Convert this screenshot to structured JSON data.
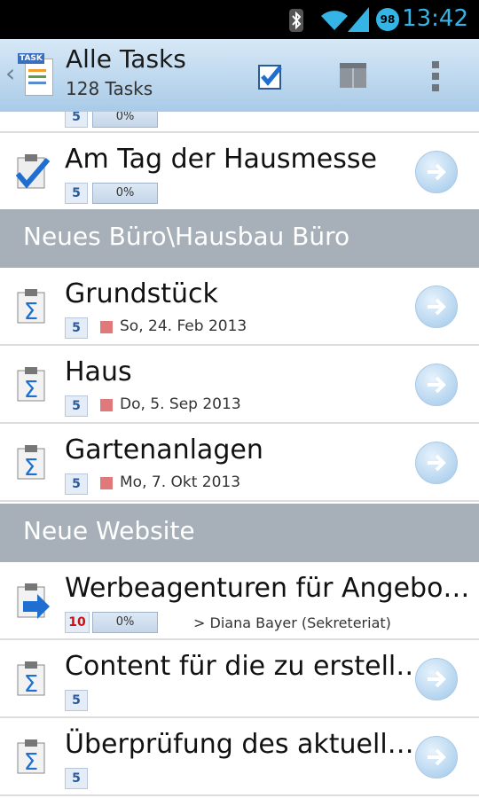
{
  "status": {
    "time": "13:42",
    "battery": "98"
  },
  "appbar": {
    "title": "Alle Tasks",
    "subtitle": "128 Tasks",
    "app_badge": "TASK"
  },
  "rows": {
    "top": {
      "prio": "5",
      "progress": "0%"
    },
    "r1": {
      "title": "Am Tag der Hausmesse",
      "prio": "5",
      "progress": "0%"
    },
    "sec1": "Neues Büro\\Hausbau Büro",
    "r2": {
      "title": "Grundstück",
      "prio": "5",
      "date": "So, 24. Feb 2013"
    },
    "r3": {
      "title": "Haus",
      "prio": "5",
      "date": "Do,  5. Sep 2013"
    },
    "r4": {
      "title": "Gartenanlagen",
      "prio": "5",
      "date": "Mo,  7. Okt 2013"
    },
    "sec2": "Neue Website",
    "r5": {
      "title": "Werbeagenturen für Angebo…",
      "prio": "10",
      "progress": "0%",
      "assignee": "> Diana Bayer (Sekreteriat)"
    },
    "r6": {
      "title": "Content für die zu erstell…",
      "prio": "5"
    },
    "r7": {
      "title": "Überprüfung des aktuell…",
      "prio": "5"
    }
  }
}
